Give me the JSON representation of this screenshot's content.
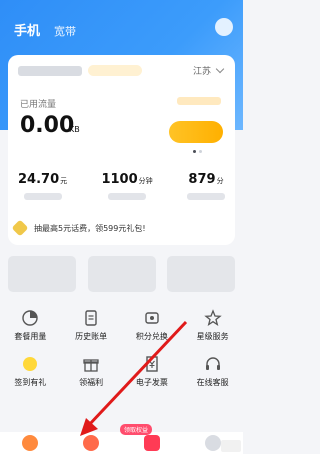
{
  "header": {
    "tabs": [
      {
        "label": "手机"
      },
      {
        "label": "宽带"
      }
    ]
  },
  "account": {
    "province": "江苏",
    "used_traffic_label": "已用流量",
    "used_traffic_value": "0.00",
    "used_traffic_unit": "KB"
  },
  "metrics": [
    {
      "value": "24.70",
      "unit": "元"
    },
    {
      "value": "1100",
      "unit": "分钟"
    },
    {
      "value": "879",
      "unit": "分"
    }
  ],
  "promo": {
    "text": "抽最高5元话费，领599元礼包!"
  },
  "services": {
    "row1": [
      {
        "label": "套餐用量",
        "icon": "package-usage-icon"
      },
      {
        "label": "历史账单",
        "icon": "bill-icon"
      },
      {
        "label": "积分兑换",
        "icon": "points-icon"
      },
      {
        "label": "星级服务",
        "icon": "star-service-icon"
      }
    ],
    "row2": [
      {
        "label": "签到有礼",
        "icon": "checkin-icon"
      },
      {
        "label": "领福利",
        "icon": "gift-icon"
      },
      {
        "label": "电子发票",
        "icon": "invoice-icon"
      },
      {
        "label": "在线客服",
        "icon": "headset-icon"
      }
    ]
  },
  "bottom_nav": {
    "badge_text": "领取权益"
  },
  "colors": {
    "brand_blue": "#2f8ef7",
    "accent_yellow": "#ffc326",
    "arrow_red": "#e01a1a"
  }
}
